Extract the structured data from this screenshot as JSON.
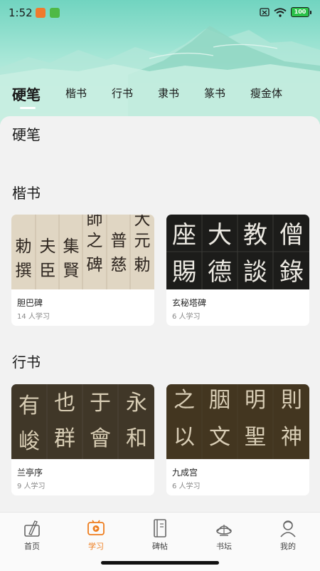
{
  "status_bar": {
    "time": "1:52",
    "battery": "100"
  },
  "tabs": [
    {
      "label": "硬笔",
      "active": true
    },
    {
      "label": "楷书",
      "active": false
    },
    {
      "label": "行书",
      "active": false
    },
    {
      "label": "隶书",
      "active": false
    },
    {
      "label": "篆书",
      "active": false
    },
    {
      "label": "瘦金体",
      "active": false
    }
  ],
  "sections": [
    {
      "title": "硬笔",
      "cards": []
    },
    {
      "title": "楷书",
      "cards": [
        {
          "title": "胆巴碑",
          "learners": "14 人学习",
          "image_text": [
            "師",
            "夫",
            "集",
            "之",
            "普",
            "元",
            "勅",
            "撰",
            "臣",
            "賢",
            "碑",
            "慈",
            "勅",
            "大"
          ]
        },
        {
          "title": "玄秘塔碑",
          "learners": "6 人学习",
          "image_text": [
            "座",
            "賜",
            "大",
            "德",
            "教",
            "談",
            "僧",
            "錄"
          ]
        }
      ]
    },
    {
      "title": "行书",
      "cards": [
        {
          "title": "兰亭序",
          "learners": "9 人学习",
          "image_text": [
            "有",
            "峻",
            "也",
            "群",
            "于",
            "會",
            "永",
            "和"
          ]
        },
        {
          "title": "九成宫",
          "learners": "6 人学习",
          "image_text": [
            "之",
            "以",
            "胭",
            "文",
            "明",
            "聖",
            "則",
            "神"
          ]
        }
      ]
    }
  ],
  "bottom_nav": [
    {
      "label": "首页",
      "icon": "home-brush-icon",
      "active": false
    },
    {
      "label": "学习",
      "icon": "study-video-icon",
      "active": true
    },
    {
      "label": "碑帖",
      "icon": "book-icon",
      "active": false
    },
    {
      "label": "书坛",
      "icon": "forum-icon",
      "active": false
    },
    {
      "label": "我的",
      "icon": "profile-icon",
      "active": false
    }
  ],
  "colors": {
    "accent": "#ee7d1e",
    "header_green": "#71d4c0",
    "battery_green": "#2bc14a"
  }
}
